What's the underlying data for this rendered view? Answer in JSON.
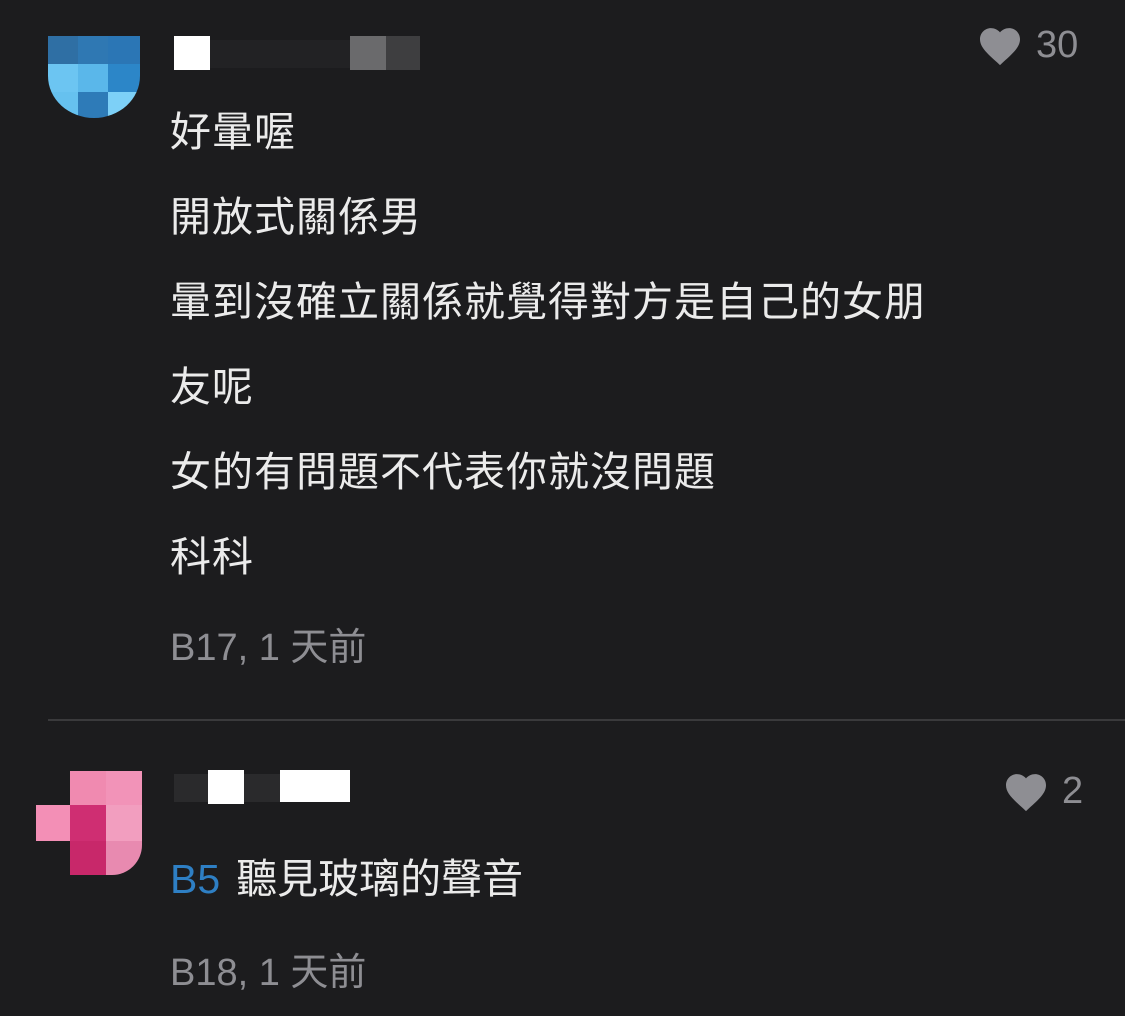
{
  "comments": [
    {
      "likes": "30",
      "lines": [
        "好暈喔",
        "開放式關係男",
        "暈到沒確立關係就覺得對方是自己的女朋",
        "友呢",
        "女的有問題不代表你就沒問題",
        "科科"
      ],
      "meta": "B17, 1 天前"
    },
    {
      "likes": "2",
      "reply_to": "B5",
      "text": "聽見玻璃的聲音",
      "meta": "B18, 1 天前"
    }
  ],
  "colors": {
    "background": "#1c1c1e",
    "text": "#ebebeb",
    "muted": "#8e8e93",
    "link": "#2e7fc4",
    "divider": "#3a3a3c"
  },
  "icons": {
    "like": "heart-icon",
    "avatar_1": "avatar-pixelated-blue",
    "avatar_2": "avatar-pixelated-pink"
  }
}
